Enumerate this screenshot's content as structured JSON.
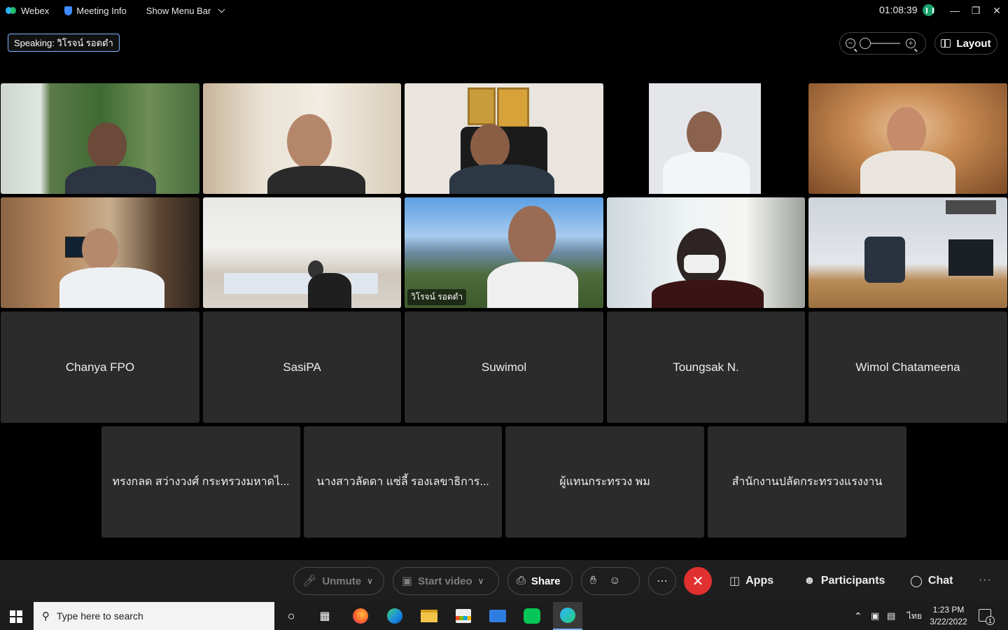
{
  "titlebar": {
    "app_name": "Webex",
    "meeting_info": "Meeting Info",
    "show_menu_bar": "Show Menu Bar",
    "timer": "01:08:39"
  },
  "speaking": {
    "label": "Speaking: วิโรจน์ รอดดำ"
  },
  "view": {
    "layout_label": "Layout",
    "zoom_fraction": 0.0
  },
  "video_tiles": [
    {
      "name": "",
      "active": false
    },
    {
      "name": "",
      "active": false
    },
    {
      "name": "",
      "active": false
    },
    {
      "name": "",
      "active": false
    },
    {
      "name": "",
      "active": false
    },
    {
      "name": "",
      "active": false
    },
    {
      "name": "",
      "active": false
    },
    {
      "name": "วิโรจน์ รอดดำ",
      "active": true
    },
    {
      "name": "",
      "active": false
    },
    {
      "name": "",
      "active": false
    }
  ],
  "name_tiles_row1": [
    "Chanya FPO",
    "SasiPA",
    "Suwimol",
    "Toungsak N.",
    "Wimol Chatameena"
  ],
  "name_tiles_row2": [
    "ทรงกลด สว่างวงศ์ กระทรวงมหาดไ...",
    "นางสาวลัดดา แซ่ลี้ รองเลขาธิการ...",
    "ผู้แทนกระทรวง พม",
    "สำนักงานปลัดกระทรวงแรงงาน"
  ],
  "controls": {
    "unmute": "Unmute",
    "start_video": "Start video",
    "share": "Share",
    "apps": "Apps",
    "participants": "Participants",
    "chat": "Chat"
  },
  "taskbar": {
    "search_placeholder": "Type here to search",
    "language": "ไทย",
    "time": "1:23 PM",
    "date": "3/22/2022",
    "notification_count": "1"
  }
}
